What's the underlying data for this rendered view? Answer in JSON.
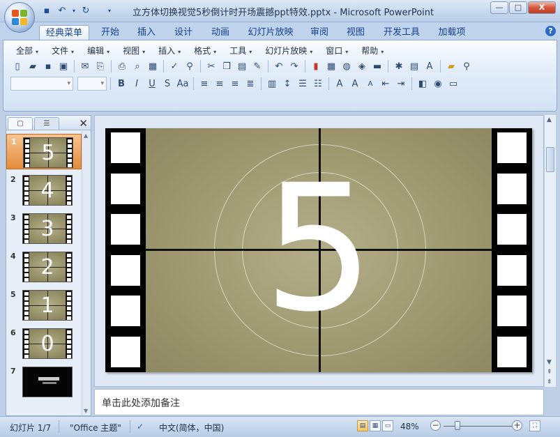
{
  "window": {
    "title": "立方体切换视觉5秒倒计时开场震撼ppt特效.pptx - Microsoft PowerPoint",
    "controls": [
      "—",
      "□",
      "X"
    ]
  },
  "quick_access": [
    "save-icon",
    "undo-icon",
    "redo-icon",
    "customize-icon"
  ],
  "tabs": [
    "经典菜单",
    "开始",
    "插入",
    "设计",
    "动画",
    "幻灯片放映",
    "审阅",
    "视图",
    "开发工具",
    "加载项"
  ],
  "active_tab": "经典菜单",
  "menu": [
    "全部",
    "文件",
    "编辑",
    "视图",
    "插入",
    "格式",
    "工具",
    "幻灯片放映",
    "窗口",
    "帮助"
  ],
  "thumbnails": [
    {
      "num": "1",
      "digit": "5",
      "selected": true
    },
    {
      "num": "2",
      "digit": "4",
      "selected": false
    },
    {
      "num": "3",
      "digit": "3",
      "selected": false
    },
    {
      "num": "4",
      "digit": "2",
      "selected": false
    },
    {
      "num": "5",
      "digit": "1",
      "selected": false
    },
    {
      "num": "6",
      "digit": "0",
      "selected": false
    },
    {
      "num": "7",
      "digit": "",
      "selected": false,
      "dark": true
    }
  ],
  "slide": {
    "digit": "5"
  },
  "notes_placeholder": "单击此处添加备注",
  "status": {
    "slide_info": "幻灯片 1/7",
    "theme": "\"Office 主题\"",
    "language": "中文(简体，中国)",
    "zoom": "48%"
  }
}
